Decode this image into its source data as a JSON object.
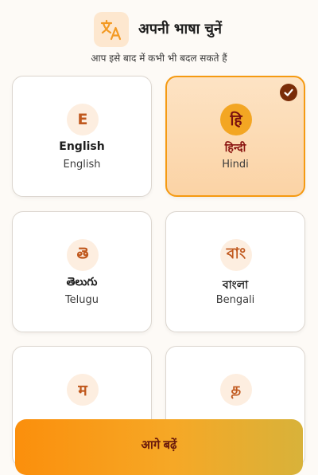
{
  "header": {
    "icon": "translate-icon",
    "title": "अपनी भाषा चुनें",
    "subtitle": "आप इसे बाद में कभी भी बदल सकते हैं"
  },
  "languages": [
    {
      "glyph": "E",
      "native": "English",
      "english": "English",
      "selected": false
    },
    {
      "glyph": "हि",
      "native": "हिन्दी",
      "english": "Hindi",
      "selected": true
    },
    {
      "glyph": "తె",
      "native": "తెలుగు",
      "english": "Telugu",
      "selected": false
    },
    {
      "glyph": "বাং",
      "native": "বাংলা",
      "english": "Bengali",
      "selected": false
    },
    {
      "glyph": "म",
      "native": "",
      "english": "",
      "selected": false
    },
    {
      "glyph": "த",
      "native": "",
      "english": "",
      "selected": false
    }
  ],
  "cta": {
    "label": "आगे बढ़ें"
  },
  "colors": {
    "accent": "#f59a12",
    "selected_text": "#8b1410",
    "check": "#7a2c08"
  }
}
